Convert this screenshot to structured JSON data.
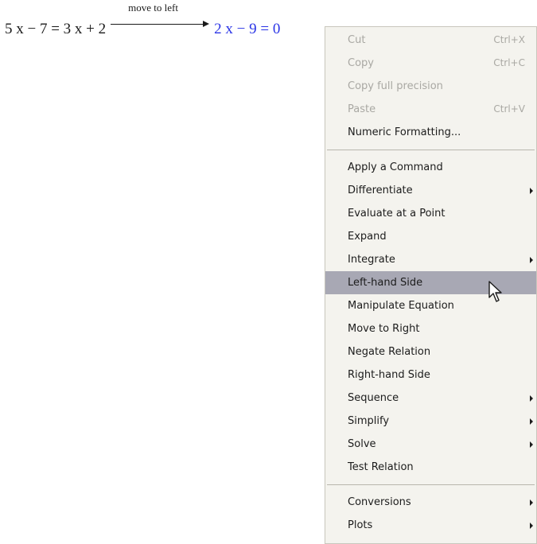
{
  "expression": {
    "lhs": "5 x − 7 = 3 x + 2",
    "arrow_label": "move to left",
    "result": "2 x − 9 = 0"
  },
  "context_menu": {
    "edit_items": [
      {
        "label": "Cut",
        "shortcut": "Ctrl+X",
        "enabled": false
      },
      {
        "label": "Copy",
        "shortcut": "Ctrl+C",
        "enabled": false
      },
      {
        "label": "Copy full precision",
        "shortcut": "",
        "enabled": false
      },
      {
        "label": "Paste",
        "shortcut": "Ctrl+V",
        "enabled": false
      },
      {
        "label": "Numeric Formatting...",
        "shortcut": "",
        "enabled": true
      }
    ],
    "command_items": [
      {
        "label": "Apply a Command",
        "submenu": false
      },
      {
        "label": "Differentiate",
        "submenu": true
      },
      {
        "label": "Evaluate at a Point",
        "submenu": false
      },
      {
        "label": "Expand",
        "submenu": false
      },
      {
        "label": "Integrate",
        "submenu": true
      },
      {
        "label": "Left-hand Side",
        "submenu": false,
        "highlighted": true
      },
      {
        "label": "Manipulate Equation",
        "submenu": false
      },
      {
        "label": "Move to Right",
        "submenu": false
      },
      {
        "label": "Negate Relation",
        "submenu": false
      },
      {
        "label": "Right-hand Side",
        "submenu": false
      },
      {
        "label": "Sequence",
        "submenu": true
      },
      {
        "label": "Simplify",
        "submenu": true
      },
      {
        "label": "Solve",
        "submenu": true
      },
      {
        "label": "Test Relation",
        "submenu": false
      }
    ],
    "other_items": [
      {
        "label": "Conversions",
        "submenu": true
      },
      {
        "label": "Plots",
        "submenu": true
      }
    ]
  },
  "colors": {
    "result_text": "#2a34e6",
    "menu_background": "#f4f3ee",
    "highlight": "#a8a8b4",
    "disabled_text": "#a9a8a3"
  },
  "icons": {
    "cursor": "mouse-pointer-icon",
    "submenu": "submenu-arrow-icon"
  }
}
